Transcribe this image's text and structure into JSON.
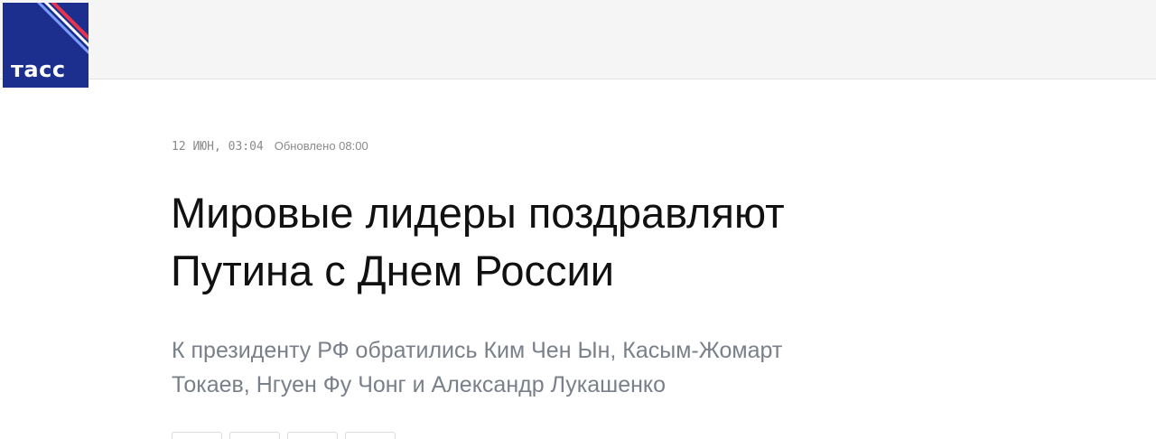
{
  "header": {
    "logo_text": "тасс",
    "logo_color": "#1c2f8e",
    "logo_stripe_colors": [
      "#e8344a",
      "#7da0ff",
      "#ffffff"
    ]
  },
  "article": {
    "date": "12 ИЮН, 03:04",
    "updated": "Обновлено 08:00",
    "title_line1": "Мировые лидеры поздравляют",
    "title_line2": "Путина с Днем России",
    "lead_line1": "К президенту РФ обратились Ким Чен Ын, Касым-Жомарт",
    "lead_line2": "Токаев, Нгуен Фу Чонг и Александр Лукашенко"
  },
  "share_buttons": [
    {
      "icon": "share-icon"
    },
    {
      "icon": "share-icon"
    },
    {
      "icon": "share-icon"
    },
    {
      "icon": "share-icon"
    }
  ]
}
